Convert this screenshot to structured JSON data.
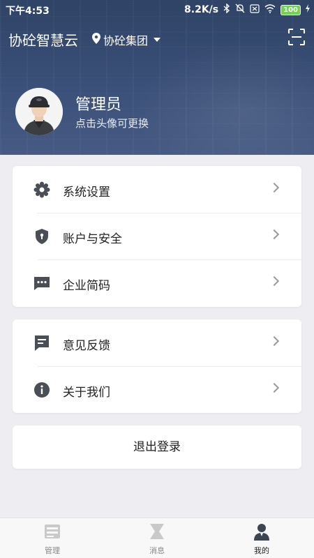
{
  "status": {
    "time": "下午4:53",
    "speed": "8.2K/s",
    "battery": "100"
  },
  "header": {
    "app_title": "协砼智慧云",
    "org_name": "协砼集团"
  },
  "profile": {
    "name": "管理员",
    "hint": "点击头像可更换"
  },
  "menu_group1": [
    {
      "label": "系统设置",
      "icon": "gear-icon"
    },
    {
      "label": "账户与安全",
      "icon": "shield-icon"
    },
    {
      "label": "企业简码",
      "icon": "message-icon"
    }
  ],
  "menu_group2": [
    {
      "label": "意见反馈",
      "icon": "feedback-icon"
    },
    {
      "label": "关于我们",
      "icon": "info-icon"
    }
  ],
  "logout_label": "退出登录",
  "tabs": [
    {
      "label": "管理",
      "icon": "manage-icon",
      "active": false
    },
    {
      "label": "消息",
      "icon": "message-tab-icon",
      "active": false
    },
    {
      "label": "我的",
      "icon": "user-icon",
      "active": true
    }
  ],
  "colors": {
    "header_bg": "#3b5078",
    "icon_dark": "#4a4f57",
    "page_bg": "#eeeef2"
  }
}
